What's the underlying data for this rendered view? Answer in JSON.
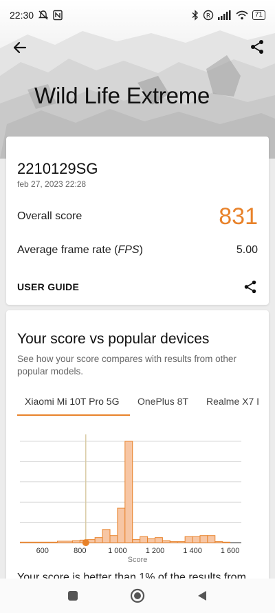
{
  "status_bar": {
    "time": "22:30",
    "battery": "71",
    "icons": [
      "mute-bell-icon",
      "nfc-icon",
      "bluetooth-icon",
      "registered-icon",
      "signal-icon",
      "wifi-icon",
      "battery-icon"
    ]
  },
  "toolbar": {
    "back_icon": "arrow-left-icon",
    "share_icon": "share-icon"
  },
  "hero": {
    "title": "Wild Life Extreme"
  },
  "result": {
    "device": "2210129SG",
    "date": "feb 27, 2023 22:28",
    "overall_label": "Overall score",
    "overall_value": "831",
    "fps_label_prefix": "Average frame rate (",
    "fps_label_unit": "FPS",
    "fps_label_suffix": ")",
    "fps_value": "5.00",
    "user_guide": "USER GUIDE",
    "accent": "#e8822a"
  },
  "comparison": {
    "title": "Your score vs popular devices",
    "description": "See how your score compares with results from other popular models.",
    "tabs": [
      "Xiaomi Mi 10T Pro 5G",
      "OnePlus 8T",
      "Realme X7 I"
    ],
    "active_tab": 0,
    "footer": "Your score is better than 1% of the results from"
  },
  "chart_data": {
    "type": "histogram",
    "xlabel": "Score",
    "xlim": [
      480,
      1660
    ],
    "ylim": [
      0,
      100
    ],
    "x_ticks": [
      600,
      800,
      1000,
      1200,
      1400,
      1600
    ],
    "x_tick_labels": [
      "600",
      "800",
      "1 000",
      "1 200",
      "1 400",
      "1 600"
    ],
    "bin_edges": [
      480,
      680,
      760,
      800,
      840,
      880,
      920,
      960,
      1000,
      1040,
      1080,
      1120,
      1160,
      1200,
      1240,
      1280,
      1320,
      1360,
      1400,
      1440,
      1480,
      1520,
      1560,
      1600,
      1660
    ],
    "values": [
      0.5,
      1.5,
      2,
      2.5,
      3,
      5,
      13,
      7,
      34,
      100,
      3,
      6,
      4,
      5,
      2,
      1,
      1,
      6,
      6,
      7,
      7,
      1,
      0.5,
      0
    ],
    "your_score": 831,
    "bar_color": "#f7c6a4",
    "bar_edge_color": "#e8822a",
    "marker_color": "#e8822a"
  },
  "nav_bar": {
    "icons": [
      "recent-apps-icon",
      "home-icon",
      "back-triangle-icon"
    ]
  }
}
